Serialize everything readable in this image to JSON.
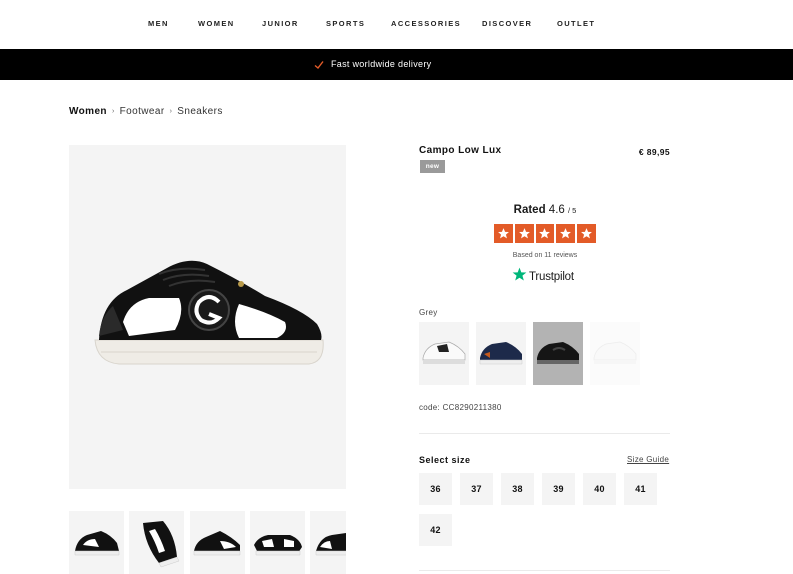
{
  "nav": {
    "items": [
      {
        "label": "MEN",
        "key": "men"
      },
      {
        "label": "WOMEN",
        "key": "women"
      },
      {
        "label": "JUNIOR",
        "key": "junior"
      },
      {
        "label": "SPORTS",
        "key": "sports"
      },
      {
        "label": "ACCESSORIES",
        "key": "accessories"
      },
      {
        "label": "DISCOVER",
        "key": "discover"
      },
      {
        "label": "OUTLET",
        "key": "outlet"
      }
    ]
  },
  "delivery": {
    "text": "Fast worldwide delivery",
    "check_color": "#e35b28"
  },
  "breadcrumb": {
    "items": [
      "Women",
      "Footwear",
      "Sneakers"
    ]
  },
  "product": {
    "name": "Campo Low Lux",
    "price": "€ 89,95",
    "badge": "new",
    "code": "code: CC8290211380"
  },
  "rating": {
    "prefix": "Rated",
    "score": "4.6",
    "out_of": "/ 5",
    "stars": 5,
    "star_color": "#e35b28",
    "reviews_text": "Based on 11 reviews",
    "provider": "Trustpilot",
    "provider_star_color": "#00b67a"
  },
  "colour": {
    "label": "Grey",
    "swatches": [
      {
        "name": "white",
        "state": "normal"
      },
      {
        "name": "navy",
        "state": "normal"
      },
      {
        "name": "grey",
        "state": "selected"
      },
      {
        "name": "light",
        "state": "faded"
      }
    ]
  },
  "sizes": {
    "label": "Select size",
    "guide_label": "Size Guide",
    "options": [
      "36",
      "37",
      "38",
      "39",
      "40",
      "41",
      "42"
    ]
  },
  "gallery": {
    "thumbnail_count": 5
  }
}
